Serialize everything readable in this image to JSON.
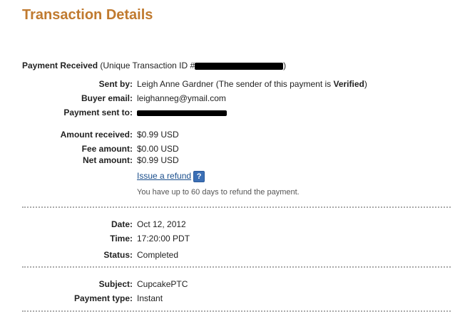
{
  "page": {
    "title": "Transaction Details"
  },
  "payment": {
    "heading": "Payment Received",
    "id_prefix": " (Unique Transaction ID #",
    "id_suffix": ")"
  },
  "details": {
    "sent_by_label": "Sent by:",
    "sent_by_name": "Leigh Anne Gardner (The sender of this payment is ",
    "sent_by_status": "Verified",
    "sent_by_close": ")",
    "buyer_email_label": "Buyer email:",
    "buyer_email_value": "leighanneg@ymail.com",
    "payment_sent_to_label": "Payment sent to:"
  },
  "amounts": {
    "amount_received_label": "Amount received:",
    "amount_received_value": "$0.99 USD",
    "fee_amount_label": "Fee amount:",
    "fee_amount_value": "$0.00 USD",
    "net_amount_label": "Net amount:",
    "net_amount_value": "$0.99 USD",
    "issue_refund_label": "Issue a refund",
    "help_icon_glyph": "?",
    "refund_note": "You have up to 60 days to refund the payment."
  },
  "status_section": {
    "date_label": "Date:",
    "date_value": "Oct 12, 2012",
    "time_label": "Time:",
    "time_value": "17:20:00 PDT",
    "status_label": "Status:",
    "status_value": "Completed"
  },
  "item_section": {
    "subject_label": "Subject:",
    "subject_value": "CupcakePTC",
    "payment_type_label": "Payment type:",
    "payment_type_value": "Instant"
  },
  "colors": {
    "title": "#c07a2f",
    "link": "#1a4e8c",
    "help_icon_bg": "#3b6fb5",
    "divider": "#aaaaaa"
  }
}
